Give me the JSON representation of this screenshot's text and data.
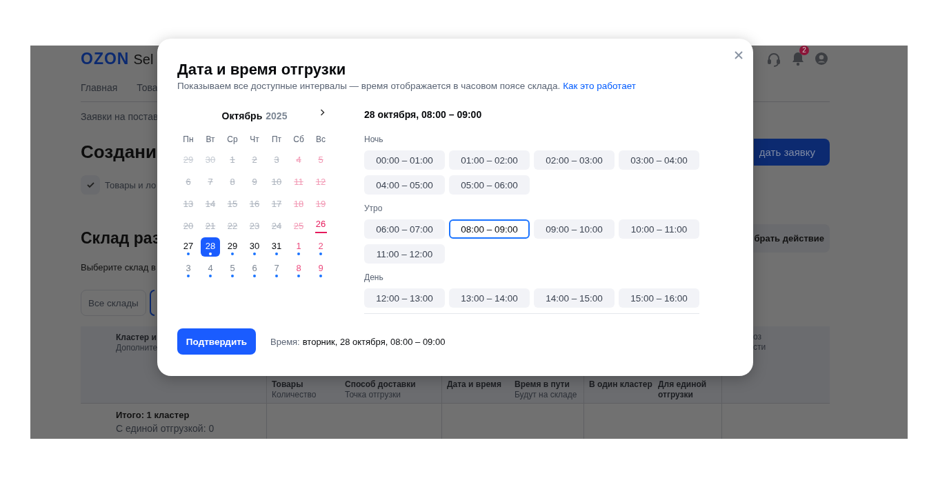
{
  "background_page": {
    "logo": "OZON",
    "logo_suffix": "Sel",
    "notification_count": "2",
    "nav": [
      "Главная",
      "Това"
    ],
    "breadcrumb": "Заявки на постав",
    "title": "Создани",
    "create_button": "дать заявку",
    "step": "Товары и ло",
    "section_title": "Склад раз",
    "action_button": "брать действие",
    "hint": "Выберите склад в",
    "filter": "Все склады",
    "table": {
      "header_title": "Кластер и",
      "header_subtitle": "Дополните",
      "header_right_title": "оз",
      "header_right_subtitle": "сти",
      "columns": [
        {
          "title": "Товары",
          "subtitle": "Количество"
        },
        {
          "title": "Способ доставки",
          "subtitle": "Точка отгрузки"
        },
        {
          "title": "Дата и время"
        },
        {
          "title": "Время в пути",
          "subtitle": "Будут на складе"
        },
        {
          "title": "В один кластер"
        },
        {
          "title": "Для единой отгрузки"
        }
      ],
      "summary_title": "Итого: 1 кластер",
      "summary_detail": "С единой отгрузкой: 0"
    }
  },
  "dialog": {
    "title": "Дата и время отгрузки",
    "subtitle": "Показываем все доступные интервалы — время отображается в часовом поясе склада.",
    "help_link": "Как это работает",
    "calendar": {
      "month": "Октябрь",
      "year": "2025",
      "weekdays": [
        "Пн",
        "Вт",
        "Ср",
        "Чт",
        "Пт",
        "Сб",
        "Вс"
      ],
      "days": [
        {
          "label": "29",
          "disabled": true,
          "today": false,
          "weekend": false,
          "adjacent_month": true,
          "selected": false
        },
        {
          "label": "30",
          "disabled": true,
          "today": false,
          "weekend": false,
          "adjacent_month": true,
          "selected": false
        },
        {
          "label": "1",
          "disabled": true,
          "today": false,
          "weekend": false,
          "adjacent_month": false,
          "selected": false
        },
        {
          "label": "2",
          "disabled": true,
          "today": false,
          "weekend": false,
          "adjacent_month": false,
          "selected": false
        },
        {
          "label": "3",
          "disabled": true,
          "today": false,
          "weekend": false,
          "adjacent_month": false,
          "selected": false
        },
        {
          "label": "4",
          "disabled": true,
          "today": false,
          "weekend": true,
          "adjacent_month": false,
          "selected": false
        },
        {
          "label": "5",
          "disabled": true,
          "today": false,
          "weekend": true,
          "adjacent_month": false,
          "selected": false
        },
        {
          "label": "6",
          "disabled": true,
          "today": false,
          "weekend": false,
          "adjacent_month": false,
          "selected": false
        },
        {
          "label": "7",
          "disabled": true,
          "today": false,
          "weekend": false,
          "adjacent_month": false,
          "selected": false
        },
        {
          "label": "8",
          "disabled": true,
          "today": false,
          "weekend": false,
          "adjacent_month": false,
          "selected": false
        },
        {
          "label": "9",
          "disabled": true,
          "today": false,
          "weekend": false,
          "adjacent_month": false,
          "selected": false
        },
        {
          "label": "10",
          "disabled": true,
          "today": false,
          "weekend": false,
          "adjacent_month": false,
          "selected": false
        },
        {
          "label": "11",
          "disabled": true,
          "today": false,
          "weekend": true,
          "adjacent_month": false,
          "selected": false
        },
        {
          "label": "12",
          "disabled": true,
          "today": false,
          "weekend": true,
          "adjacent_month": false,
          "selected": false
        },
        {
          "label": "13",
          "disabled": true,
          "today": false,
          "weekend": false,
          "adjacent_month": false,
          "selected": false
        },
        {
          "label": "14",
          "disabled": true,
          "today": false,
          "weekend": false,
          "adjacent_month": false,
          "selected": false
        },
        {
          "label": "15",
          "disabled": true,
          "today": false,
          "weekend": false,
          "adjacent_month": false,
          "selected": false
        },
        {
          "label": "16",
          "disabled": true,
          "today": false,
          "weekend": false,
          "adjacent_month": false,
          "selected": false
        },
        {
          "label": "17",
          "disabled": true,
          "today": false,
          "weekend": false,
          "adjacent_month": false,
          "selected": false
        },
        {
          "label": "18",
          "disabled": true,
          "today": false,
          "weekend": true,
          "adjacent_month": false,
          "selected": false
        },
        {
          "label": "19",
          "disabled": true,
          "today": false,
          "weekend": true,
          "adjacent_month": false,
          "selected": false
        },
        {
          "label": "20",
          "disabled": true,
          "today": false,
          "weekend": false,
          "adjacent_month": false,
          "selected": false
        },
        {
          "label": "21",
          "disabled": true,
          "today": false,
          "weekend": false,
          "adjacent_month": false,
          "selected": false
        },
        {
          "label": "22",
          "disabled": true,
          "today": false,
          "weekend": false,
          "adjacent_month": false,
          "selected": false
        },
        {
          "label": "23",
          "disabled": true,
          "today": false,
          "weekend": false,
          "adjacent_month": false,
          "selected": false
        },
        {
          "label": "24",
          "disabled": true,
          "today": false,
          "weekend": false,
          "adjacent_month": false,
          "selected": false
        },
        {
          "label": "25",
          "disabled": true,
          "today": false,
          "weekend": true,
          "adjacent_month": false,
          "selected": false
        },
        {
          "label": "26",
          "disabled": false,
          "today": true,
          "weekend": true,
          "adjacent_month": false,
          "selected": false
        },
        {
          "label": "27",
          "disabled": false,
          "today": false,
          "weekend": false,
          "adjacent_month": false,
          "selected": false
        },
        {
          "label": "28",
          "disabled": false,
          "today": false,
          "weekend": false,
          "adjacent_month": false,
          "selected": true
        },
        {
          "label": "29",
          "disabled": false,
          "today": false,
          "weekend": false,
          "adjacent_month": false,
          "selected": false
        },
        {
          "label": "30",
          "disabled": false,
          "today": false,
          "weekend": false,
          "adjacent_month": false,
          "selected": false
        },
        {
          "label": "31",
          "disabled": false,
          "today": false,
          "weekend": false,
          "adjacent_month": false,
          "selected": false
        },
        {
          "label": "1",
          "disabled": false,
          "today": false,
          "weekend": true,
          "adjacent_month": true,
          "selected": false
        },
        {
          "label": "2",
          "disabled": false,
          "today": false,
          "weekend": true,
          "adjacent_month": true,
          "selected": false
        },
        {
          "label": "3",
          "disabled": false,
          "today": false,
          "weekend": false,
          "adjacent_month": true,
          "selected": false
        },
        {
          "label": "4",
          "disabled": false,
          "today": false,
          "weekend": false,
          "adjacent_month": true,
          "selected": false
        },
        {
          "label": "5",
          "disabled": false,
          "today": false,
          "weekend": false,
          "adjacent_month": true,
          "selected": false
        },
        {
          "label": "6",
          "disabled": false,
          "today": false,
          "weekend": false,
          "adjacent_month": true,
          "selected": false
        },
        {
          "label": "7",
          "disabled": false,
          "today": false,
          "weekend": false,
          "adjacent_month": true,
          "selected": false
        },
        {
          "label": "8",
          "disabled": false,
          "today": false,
          "weekend": true,
          "adjacent_month": true,
          "selected": false
        },
        {
          "label": "9",
          "disabled": false,
          "today": false,
          "weekend": true,
          "adjacent_month": true,
          "selected": false
        }
      ]
    },
    "selection_heading": "28 октября, 08:00 – 09:00",
    "slot_groups": [
      {
        "label": "Ночь",
        "slots": [
          {
            "label": "00:00 – 01:00",
            "selected": false
          },
          {
            "label": "01:00 – 02:00",
            "selected": false
          },
          {
            "label": "02:00 – 03:00",
            "selected": false
          },
          {
            "label": "03:00 – 04:00",
            "selected": false
          },
          {
            "label": "04:00 – 05:00",
            "selected": false
          },
          {
            "label": "05:00 – 06:00",
            "selected": false
          }
        ]
      },
      {
        "label": "Утро",
        "slots": [
          {
            "label": "06:00 – 07:00",
            "selected": false
          },
          {
            "label": "08:00 – 09:00",
            "selected": true
          },
          {
            "label": "09:00 – 10:00",
            "selected": false
          },
          {
            "label": "10:00 – 11:00",
            "selected": false
          },
          {
            "label": "11:00 – 12:00",
            "selected": false
          }
        ]
      },
      {
        "label": "День",
        "slots": [
          {
            "label": "12:00 – 13:00",
            "selected": false
          },
          {
            "label": "13:00 – 14:00",
            "selected": false
          },
          {
            "label": "14:00 – 15:00",
            "selected": false
          },
          {
            "label": "15:00 – 16:00",
            "selected": false
          }
        ]
      }
    ],
    "confirm_button": "Подтвердить",
    "time_label": "Время:",
    "time_value": "вторник, 28 октября, 08:00 – 09:00"
  }
}
